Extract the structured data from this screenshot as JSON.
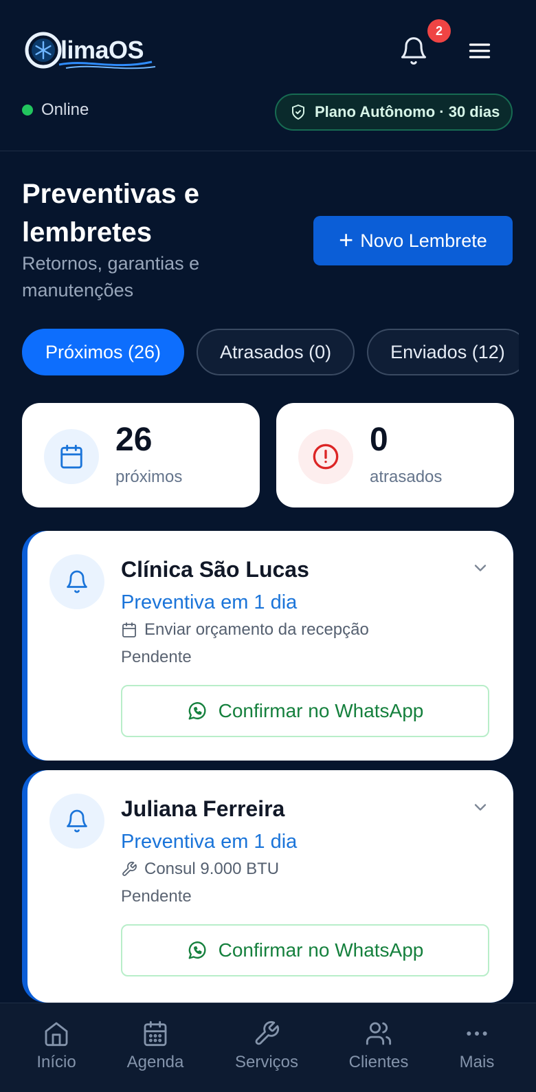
{
  "app": {
    "logo_text": "ClimaOS"
  },
  "header": {
    "notification_count": "2",
    "status_label": "Online",
    "plan_label": "Plano Autônomo · 30 dias"
  },
  "page": {
    "title": "Preventivas e lembretes",
    "subtitle": "Retornos, garantias e manutenções",
    "new_button_label": "Novo Lembrete"
  },
  "tabs": [
    {
      "label": "Próximos (26)",
      "active": true
    },
    {
      "label": "Atrasados (0)",
      "active": false
    },
    {
      "label": "Enviados (12)",
      "active": false
    }
  ],
  "stats": [
    {
      "value": "26",
      "label": "próximos",
      "icon": "calendar-icon",
      "color": "#1a74d9"
    },
    {
      "value": "0",
      "label": "atrasados",
      "icon": "alert-circle-icon",
      "color": "#dc2626"
    }
  ],
  "reminders": [
    {
      "name": "Clínica São Lucas",
      "when": "Preventiva em 1 dia",
      "detail_icon": "calendar-icon",
      "detail": "Enviar orçamento da recepção",
      "status": "Pendente",
      "action_label": "Confirmar no WhatsApp"
    },
    {
      "name": "Juliana Ferreira",
      "when": "Preventiva em 1 dia",
      "detail_icon": "wrench-icon",
      "detail": "Consul 9.000 BTU",
      "status": "Pendente",
      "action_label": "Confirmar no WhatsApp"
    }
  ],
  "bottom_nav": [
    {
      "label": "Início",
      "icon": "home-icon"
    },
    {
      "label": "Agenda",
      "icon": "calendar-icon"
    },
    {
      "label": "Serviços",
      "icon": "wrench-icon"
    },
    {
      "label": "Clientes",
      "icon": "users-icon"
    },
    {
      "label": "Mais",
      "icon": "more-icon"
    }
  ],
  "colors": {
    "background": "#06152d",
    "accent": "#0d6efd",
    "whatsapp_green": "#15803d",
    "online": "#22c55e",
    "badge": "#ef4444"
  }
}
